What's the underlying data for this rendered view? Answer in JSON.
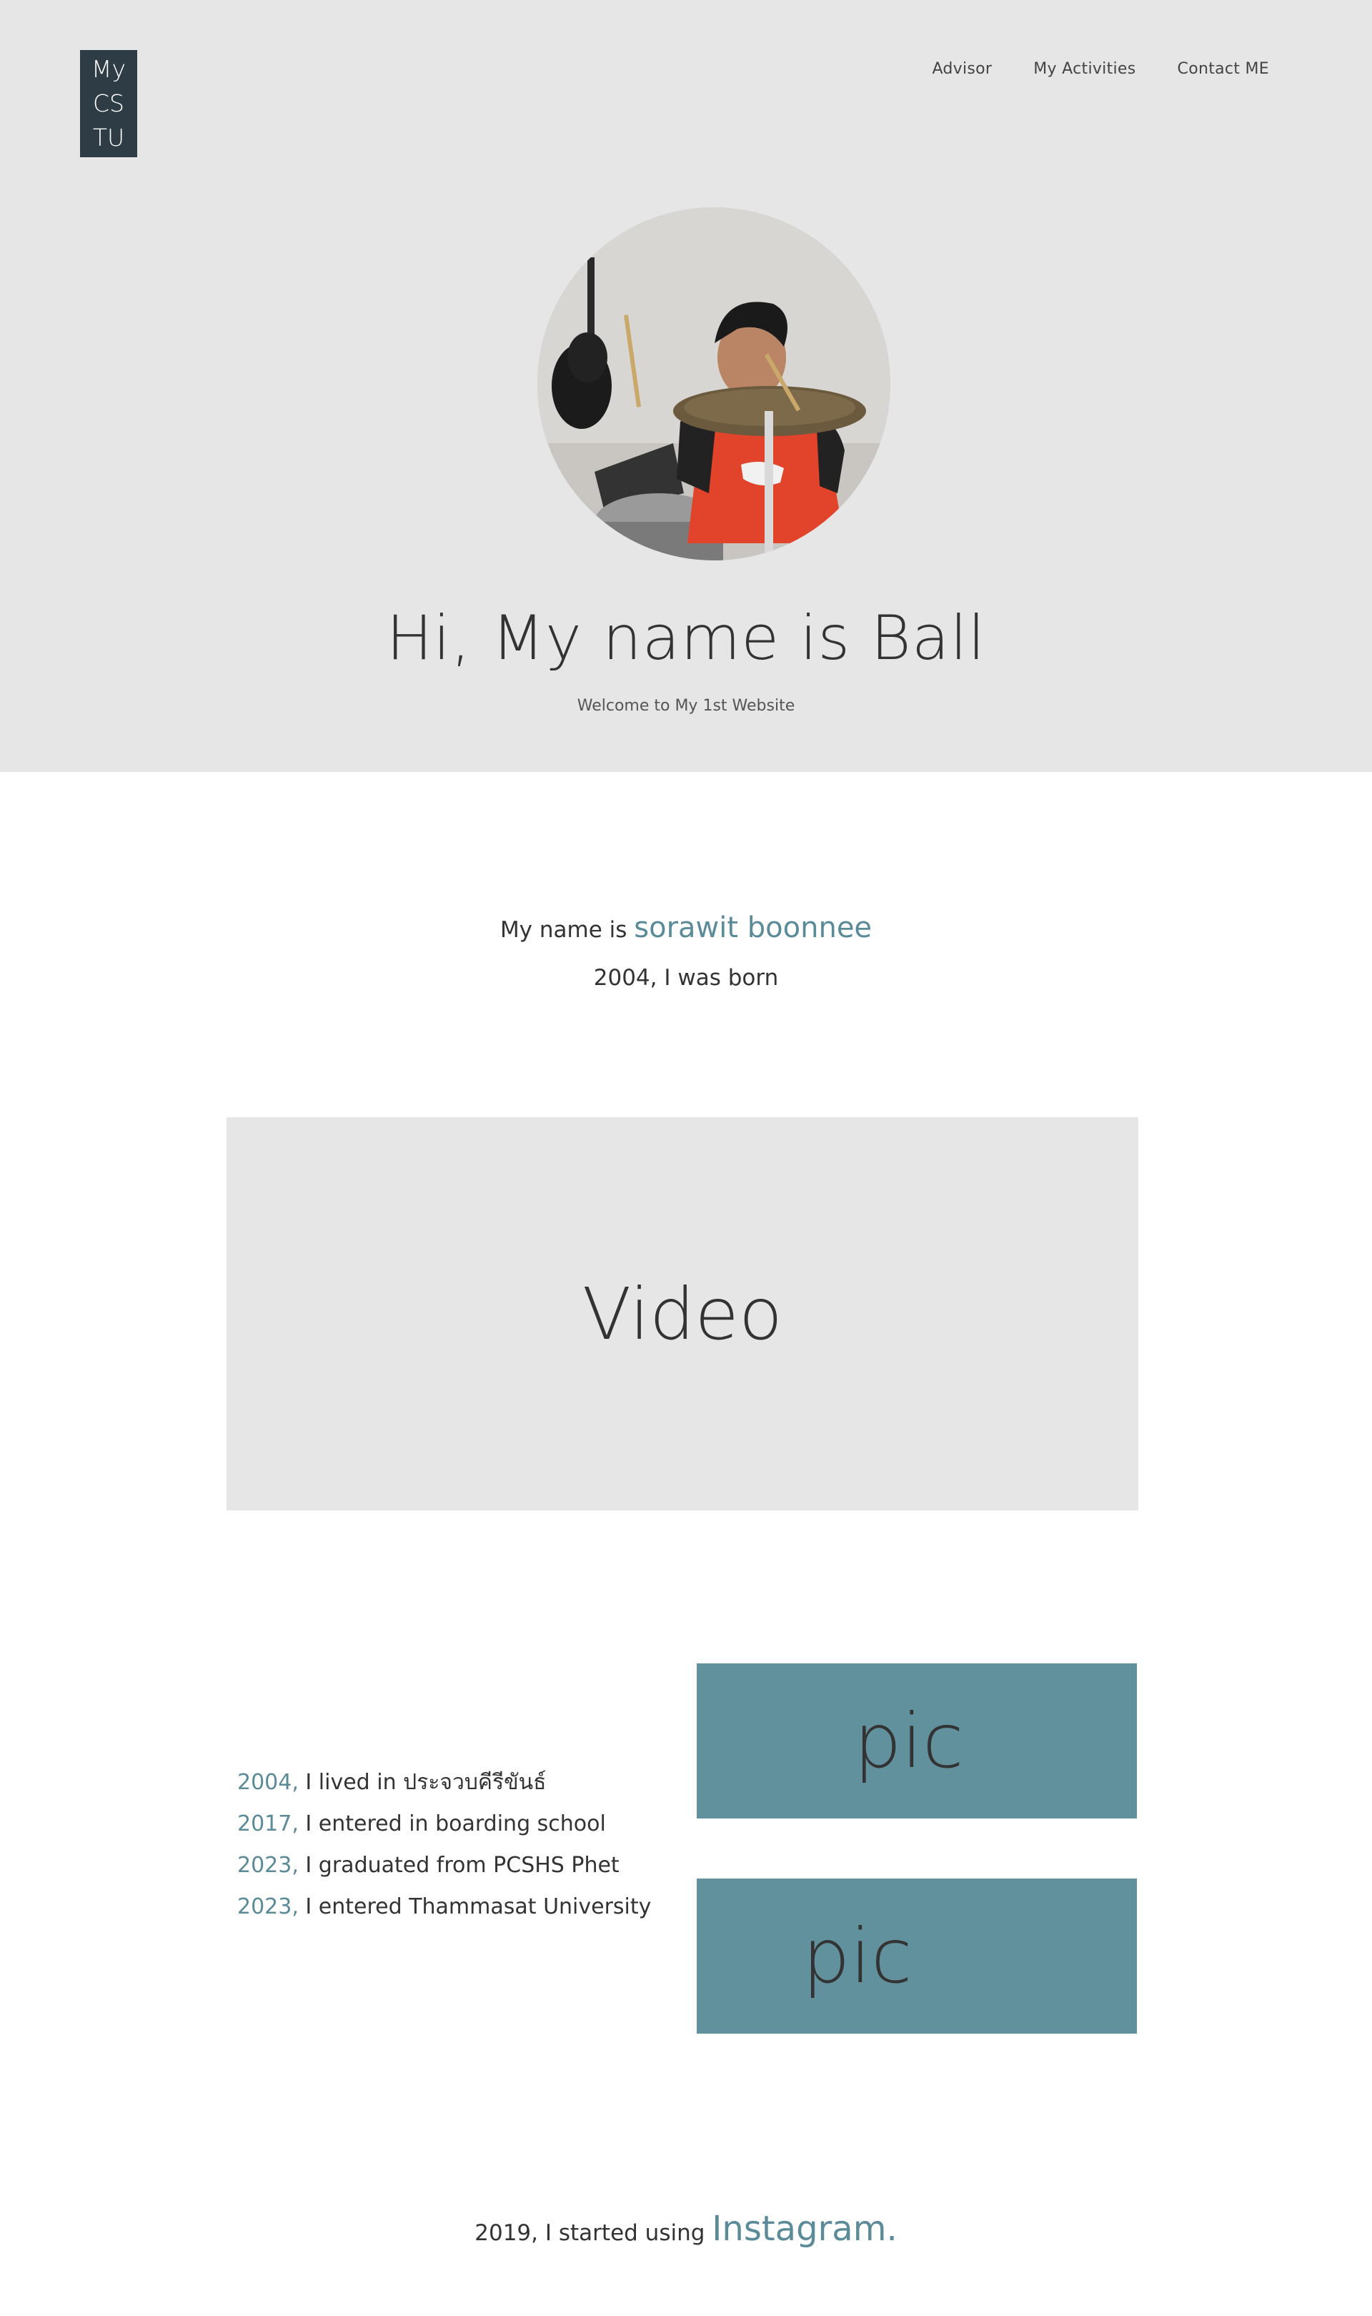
{
  "header": {
    "logo_line1": "My",
    "logo_line2": "CS",
    "logo_line3": "TU",
    "nav": [
      "Advisor",
      "My Activities",
      "Contact ME"
    ]
  },
  "hero": {
    "title": "Hi, My name is Ball",
    "subtitle": "Welcome to My 1st Website"
  },
  "intro": {
    "name_prefix": "My name is ",
    "name": "sorawit boonnee",
    "born": "2004, I was born"
  },
  "video": {
    "label": "Video"
  },
  "timeline": [
    {
      "year": "2004, ",
      "text": "I lived in ประจวบคีรีขันธ์"
    },
    {
      "year": "2017, ",
      "text": "I entered in boarding school"
    },
    {
      "year": "2023, ",
      "text": "I graduated from PCSHS Phet"
    },
    {
      "year": "2023, ",
      "text": "I entered Thammasat University"
    }
  ],
  "pics": [
    "pic",
    "pic"
  ],
  "instagram": {
    "prefix": "2019, I started using ",
    "link": "Instagram."
  },
  "colors": {
    "accent": "#5b8a98",
    "pic_bg": "#62919e",
    "logo_bg": "#2e3d45",
    "hero_bg": "#e6e6e6"
  }
}
